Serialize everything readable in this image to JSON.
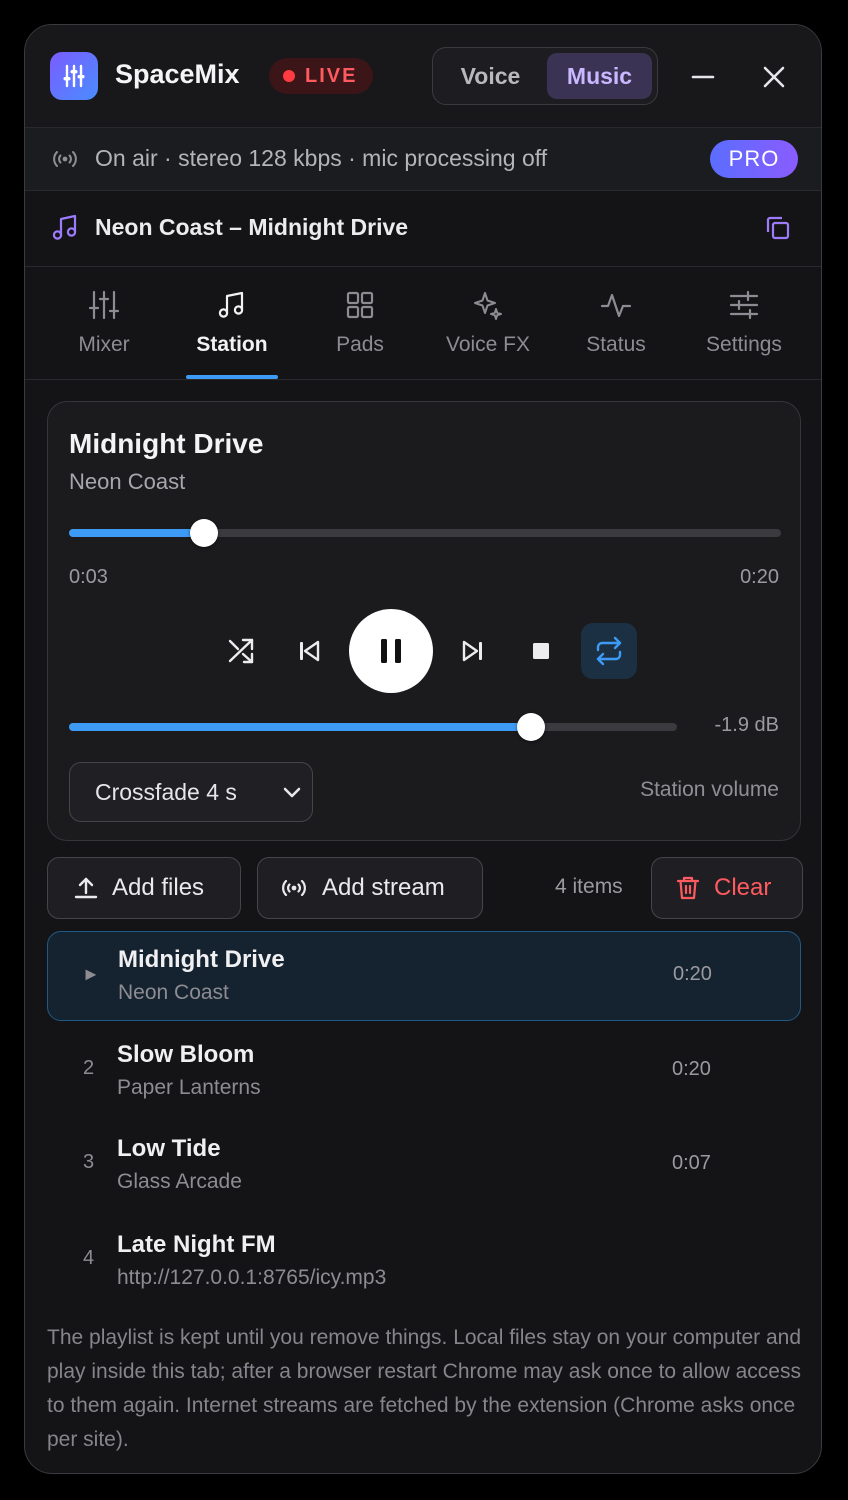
{
  "app": {
    "name": "SpaceMix",
    "live_label": "LIVE",
    "modes": [
      "Voice",
      "Music"
    ],
    "active_mode": "Music"
  },
  "status": {
    "text": "On air · stereo 128 kbps · mic processing off",
    "badge": "PRO"
  },
  "now_playing_line": "Neon Coast – Midnight Drive",
  "tabs": [
    {
      "label": "Mixer",
      "icon": "sliders-icon"
    },
    {
      "label": "Station",
      "icon": "music-note-icon"
    },
    {
      "label": "Pads",
      "icon": "grid-icon"
    },
    {
      "label": "Voice FX",
      "icon": "sparkle-icon"
    },
    {
      "label": "Status",
      "icon": "pulse-icon"
    },
    {
      "label": "Settings",
      "icon": "settings-sliders-icon"
    }
  ],
  "active_tab": "Station",
  "player": {
    "title": "Midnight Drive",
    "artist": "Neon Coast",
    "elapsed": "0:03",
    "duration": "0:20",
    "progress_fraction": 0.19,
    "volume_fraction": 0.76,
    "volume_db": "-1.9 dB",
    "repeat_on": true,
    "crossfade": "Crossfade 4 s",
    "volume_label": "Station volume"
  },
  "actions": {
    "add_files": "Add files",
    "add_stream": "Add stream",
    "count": "4 items",
    "clear": "Clear"
  },
  "playlist": [
    {
      "index": "►",
      "title": "Midnight Drive",
      "artist": "Neon Coast",
      "duration": "0:20",
      "active": true
    },
    {
      "index": "2",
      "title": "Slow Bloom",
      "artist": "Paper Lanterns",
      "duration": "0:20",
      "active": false
    },
    {
      "index": "3",
      "title": "Low Tide",
      "artist": "Glass Arcade",
      "duration": "0:07",
      "active": false
    },
    {
      "index": "4",
      "title": "Late Night FM",
      "artist": "http://127.0.0.1:8765/icy.mp3",
      "duration": "",
      "active": false
    }
  ],
  "footnote": "The playlist is kept until you remove things. Local files stay on your computer and play inside this tab; after a browser restart Chrome may ask once to allow access to them again. Internet streams are fetched by the extension (Chrome asks once per site).",
  "colors": {
    "accent": "#3d9bf5",
    "live": "#ff3b42",
    "brand_purple": "#7a5cff",
    "danger": "#ff5a5f"
  }
}
